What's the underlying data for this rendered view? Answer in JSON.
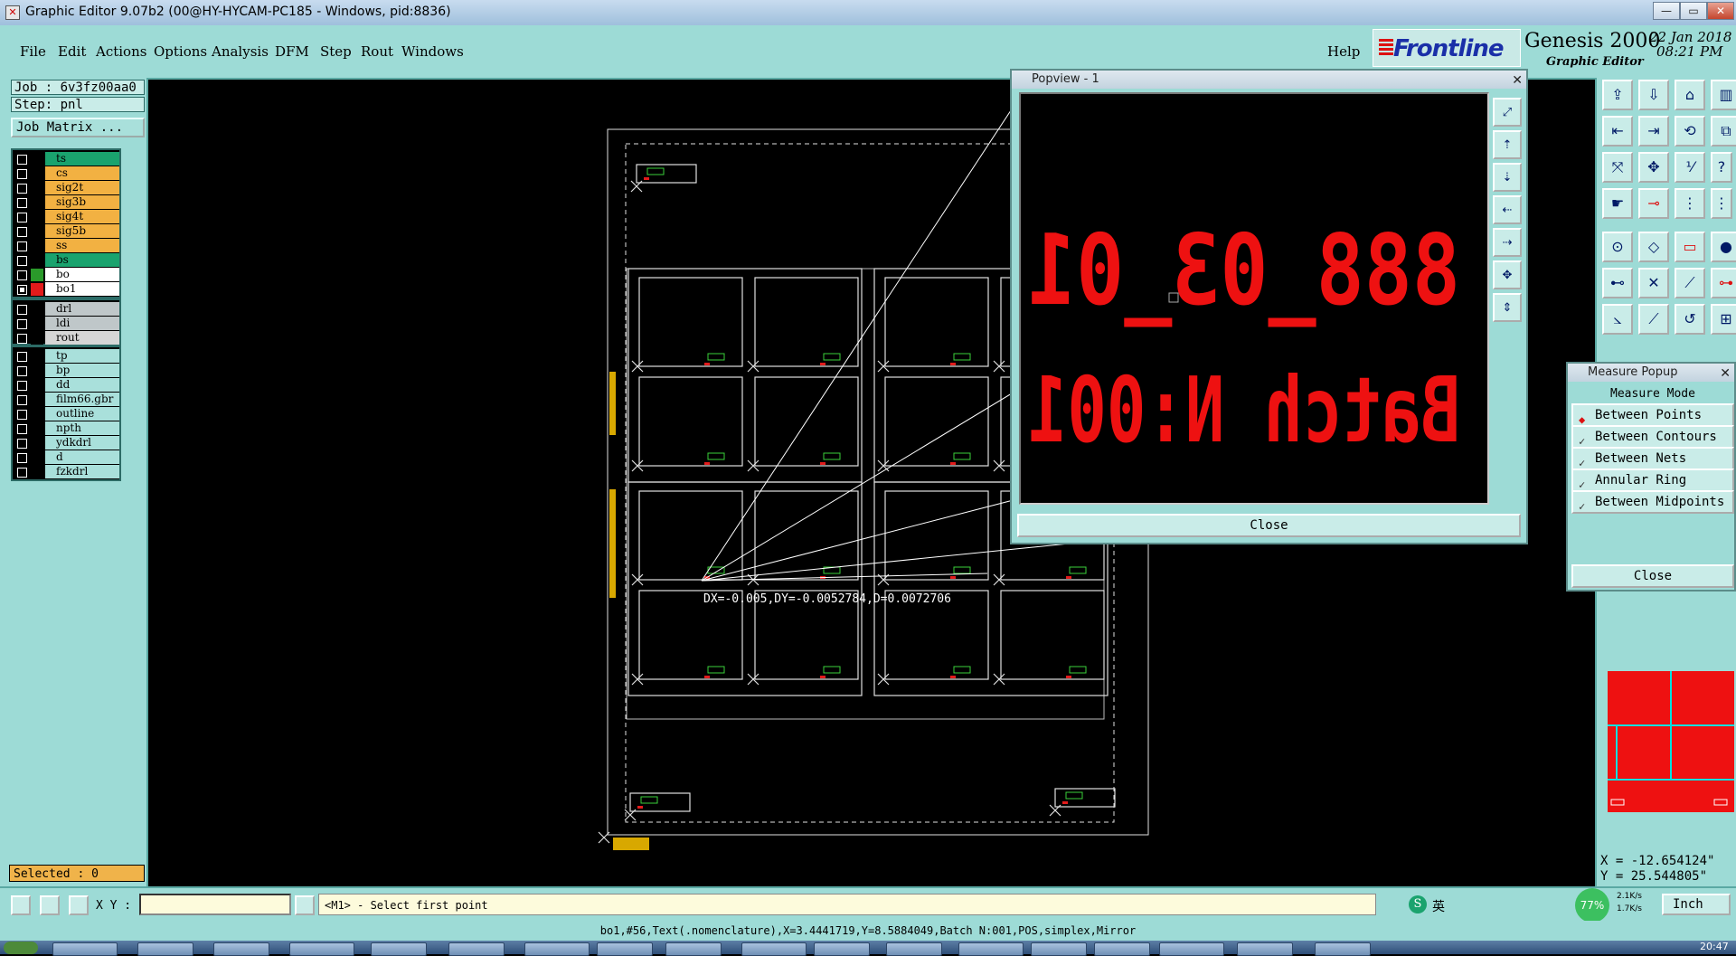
{
  "window": {
    "title": "Graphic Editor 9.07b2 (00@HY-HYCAM-PC185 - Windows, pid:8836)"
  },
  "menu": {
    "items": [
      "File",
      "Edit",
      "Actions",
      "Options",
      "Analysis",
      "DFM",
      "Step",
      "Rout",
      "Windows"
    ],
    "help": "Help"
  },
  "brand": {
    "logo": "Frontline",
    "product": "Genesis 2000",
    "subtitle": "Graphic Editor",
    "date": "22 Jan 2018",
    "time": "08:21 PM"
  },
  "job": {
    "job_label": "Job : 6v3fz00aa0",
    "step_label": "Step: pnl",
    "matrix_button": "Job Matrix ..."
  },
  "layers": {
    "group1": [
      {
        "name": "ts",
        "color": "#1aa36e",
        "checked": false
      },
      {
        "name": "cs",
        "color": "#f2b142",
        "checked": false
      },
      {
        "name": "sig2t",
        "color": "#f2b142",
        "checked": false
      },
      {
        "name": "sig3b",
        "color": "#f2b142",
        "checked": false
      },
      {
        "name": "sig4t",
        "color": "#f2b142",
        "checked": false
      },
      {
        "name": "sig5b",
        "color": "#f2b142",
        "checked": false
      },
      {
        "name": "ss",
        "color": "#f2b142",
        "checked": false
      },
      {
        "name": "bs",
        "color": "#1aa36e",
        "checked": false
      },
      {
        "name": "bo",
        "color": "#ffffff",
        "swatch": "#2a9a2a",
        "checked": false
      },
      {
        "name": "bo1",
        "color": "#ffffff",
        "swatch": "#e21b1b",
        "checked": true
      }
    ],
    "group2": [
      {
        "name": "drl",
        "color": "#bfc7c9",
        "checked": false
      },
      {
        "name": "ldi",
        "color": "#bfc7c9",
        "checked": false
      },
      {
        "name": "rout",
        "color": "#d6d6d6",
        "checked": false
      }
    ],
    "group3": [
      {
        "name": "tp",
        "color": "#a9e0db",
        "checked": false
      },
      {
        "name": "bp",
        "color": "#a9e0db",
        "checked": false
      },
      {
        "name": "dd",
        "color": "#a9e0db",
        "checked": false
      },
      {
        "name": "film66.gbr",
        "color": "#a9e0db",
        "checked": false
      },
      {
        "name": "outline",
        "color": "#a9e0db",
        "checked": false
      },
      {
        "name": "npth",
        "color": "#a9e0db",
        "checked": false
      },
      {
        "name": "ydkdrl",
        "color": "#a9e0db",
        "checked": false
      },
      {
        "name": "d",
        "color": "#a9e0db",
        "checked": false
      },
      {
        "name": "fzkdrl",
        "color": "#a9e0db",
        "checked": false
      }
    ]
  },
  "selection": {
    "label": "Selected : 0"
  },
  "command": {
    "xy_label": "X Y :",
    "xy_value": "",
    "prompt": "<M1> - Select first point",
    "unit": "Inch"
  },
  "status_line": "bo1,#56,Text(.nomenclature),X=3.4441719,Y=8.5884049,Batch N:001,POS,simplex,Mirror",
  "cursor": {
    "x_label": "X = -12.654124\"",
    "y_label": "Y = 25.544805\""
  },
  "canvas": {
    "measure_text": "DX=-0.005,DY=-0.0052784,D=0.0072706"
  },
  "popview": {
    "title": "Popview - 1",
    "line1": "888_03_01",
    "line2": "Batch N:001",
    "close_label": "Close"
  },
  "measure_popup": {
    "title": "Measure Popup",
    "header": "Measure Mode",
    "options": [
      "Between Points",
      "Between Contours",
      "Between Nets",
      "Annular Ring",
      "Between Midpoints"
    ],
    "selected_index": 0,
    "close_label": "Close"
  },
  "tray": {
    "ime": "英",
    "battery": "77%",
    "net_up": "2.1K/s",
    "net_down": "1.7K/s",
    "clock": "20:47"
  },
  "colors": {
    "panel": "#9ddbd6",
    "accent_red": "#e21b1b",
    "board_outline": "#e0e0e0",
    "marker_green": "#3ad13a"
  }
}
